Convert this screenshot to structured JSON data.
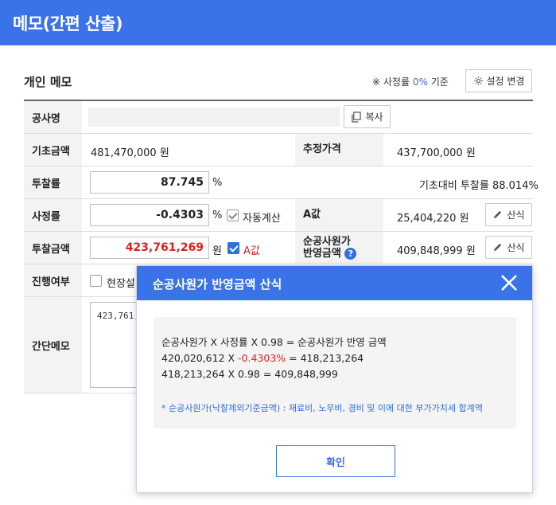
{
  "header": {
    "title": "메모(간편 산출)"
  },
  "section": {
    "title": "개인 메모",
    "rate_note_prefix": "※ 사정률",
    "rate_note_value": "0%",
    "rate_note_suffix": "기준",
    "setting_button": "설정 변경"
  },
  "form": {
    "project_name": {
      "label": "공사명",
      "value": "",
      "copy_button": "복사"
    },
    "base_amount": {
      "label": "기초금액",
      "value": "481,470,000 원"
    },
    "estimated_price": {
      "label": "추정가격",
      "value": "437,700,000 원"
    },
    "bid_rate": {
      "label": "투찰률",
      "value": "87.745",
      "unit": "%",
      "note": "기초대비 투찰률 88.014%"
    },
    "assess_rate": {
      "label": "사정률",
      "value": "-0.4303",
      "unit": "%",
      "auto_calc_label": "자동계산"
    },
    "a_value": {
      "label": "A값",
      "value": "25,404,220 원",
      "formula_button": "산식"
    },
    "bid_amount": {
      "label": "투찰금액",
      "value": "423,761,269",
      "unit": "원",
      "a_checkbox_label": "A값"
    },
    "net_cost": {
      "label_line1": "순공사원가",
      "label_line2": "반영금액",
      "help": "?",
      "value": "409,848,999 원",
      "formula_button": "산식"
    },
    "progress": {
      "label": "진행여부",
      "checkbox_label": "현장설"
    },
    "memo": {
      "label": "간단메모",
      "value": "423,761,"
    }
  },
  "modal": {
    "title": "순공사원가 반영금액 산식",
    "line1": "순공사원가 X 사정률 X 0.98 = 순공사원가 반영 금액",
    "line2_a": "420,020,612 X ",
    "line2_rate": "-0.4303%",
    "line2_b": " = 418,213,264",
    "line3": "418,213,264 X 0.98 = 409,848,999",
    "footnote": "* 순공사원가(낙찰제외기준금액) : 재료비, 노무비, 경비 및 이에 대한 부가가치세 합계액",
    "ok_button": "확인"
  },
  "colors": {
    "accent": "#3a73e8",
    "red": "#e02020",
    "blue_text": "#2f6fe0"
  }
}
